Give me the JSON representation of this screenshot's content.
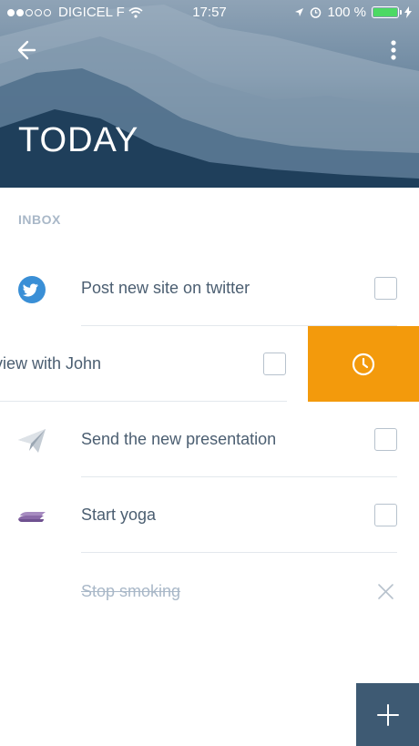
{
  "status_bar": {
    "carrier": "DIGICEL F",
    "time": "17:57",
    "battery": "100 %",
    "signal_bars_filled": 2,
    "signal_bars_total": 5,
    "battery_level": 1.0
  },
  "header": {
    "title": "TODAY",
    "back_icon": "arrow-left-icon",
    "menu_icon": "more-vertical-icon"
  },
  "section": {
    "label": "INBOX"
  },
  "tasks": [
    {
      "label": "Post new site on twitter",
      "icon": "twitter-icon",
      "state": "open"
    },
    {
      "label": "rview with John",
      "icon": "none",
      "state": "swiped",
      "action_icon": "clock-icon"
    },
    {
      "label": "Send the new presentation",
      "icon": "paper-plane-icon",
      "state": "open"
    },
    {
      "label": "Start yoga",
      "icon": "yoga-mat-icon",
      "state": "open"
    },
    {
      "label": "Stop smoking",
      "icon": "none",
      "state": "done"
    }
  ],
  "fab": {
    "icon": "plus-icon"
  },
  "colors": {
    "accent_orange": "#f39a0c",
    "fab_background": "#3e5a73",
    "text_primary": "#4b5e71",
    "text_muted": "#a9b8c8",
    "twitter_blue": "#3a8fd6",
    "yoga_purple": "#8a6aa8",
    "battery_green": "#4cd964"
  }
}
